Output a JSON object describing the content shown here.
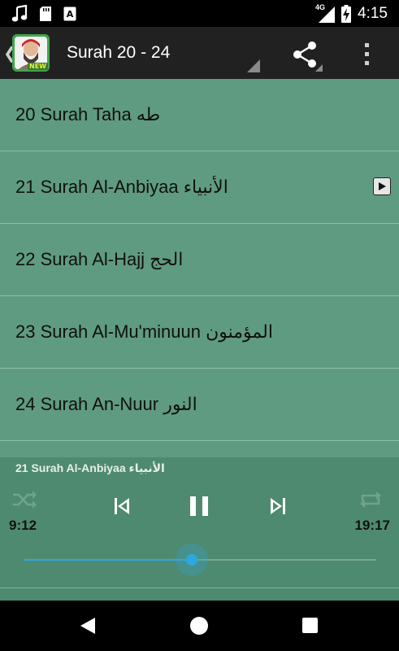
{
  "status_bar": {
    "time": "4:15",
    "network": "4G",
    "icons": [
      "music-note-icon",
      "sd-card-icon",
      "keyboard-a-icon",
      "signal-icon",
      "battery-charging-icon"
    ]
  },
  "action_bar": {
    "title": "Surah 20 - 24",
    "app_icon_badge": "NEW",
    "icons": [
      "back-chevron-icon",
      "share-icon",
      "overflow-menu-icon"
    ]
  },
  "surahs": [
    {
      "label": "20 Surah Taha طه",
      "playing": false
    },
    {
      "label": "21 Surah Al-Anbiyaa الأنبياء",
      "playing": true
    },
    {
      "label": "22 Surah Al-Hajj الحج",
      "playing": false
    },
    {
      "label": "23 Surah Al-Mu'minuun المؤمنون",
      "playing": false
    },
    {
      "label": "24 Surah An-Nuur النور",
      "playing": false
    }
  ],
  "player": {
    "now_playing": "21 Surah Al-Anbiyaa الأنبياء",
    "elapsed": "9:12",
    "duration": "19:17",
    "progress": 0.477,
    "icons": [
      "shuffle-icon",
      "previous-icon",
      "pause-icon",
      "next-icon",
      "repeat-icon"
    ]
  },
  "colors": {
    "list_background": "#5f9b80",
    "player_background": "#4e8a70",
    "action_bar": "#212121",
    "seek_accent": "#2fa7e0"
  }
}
